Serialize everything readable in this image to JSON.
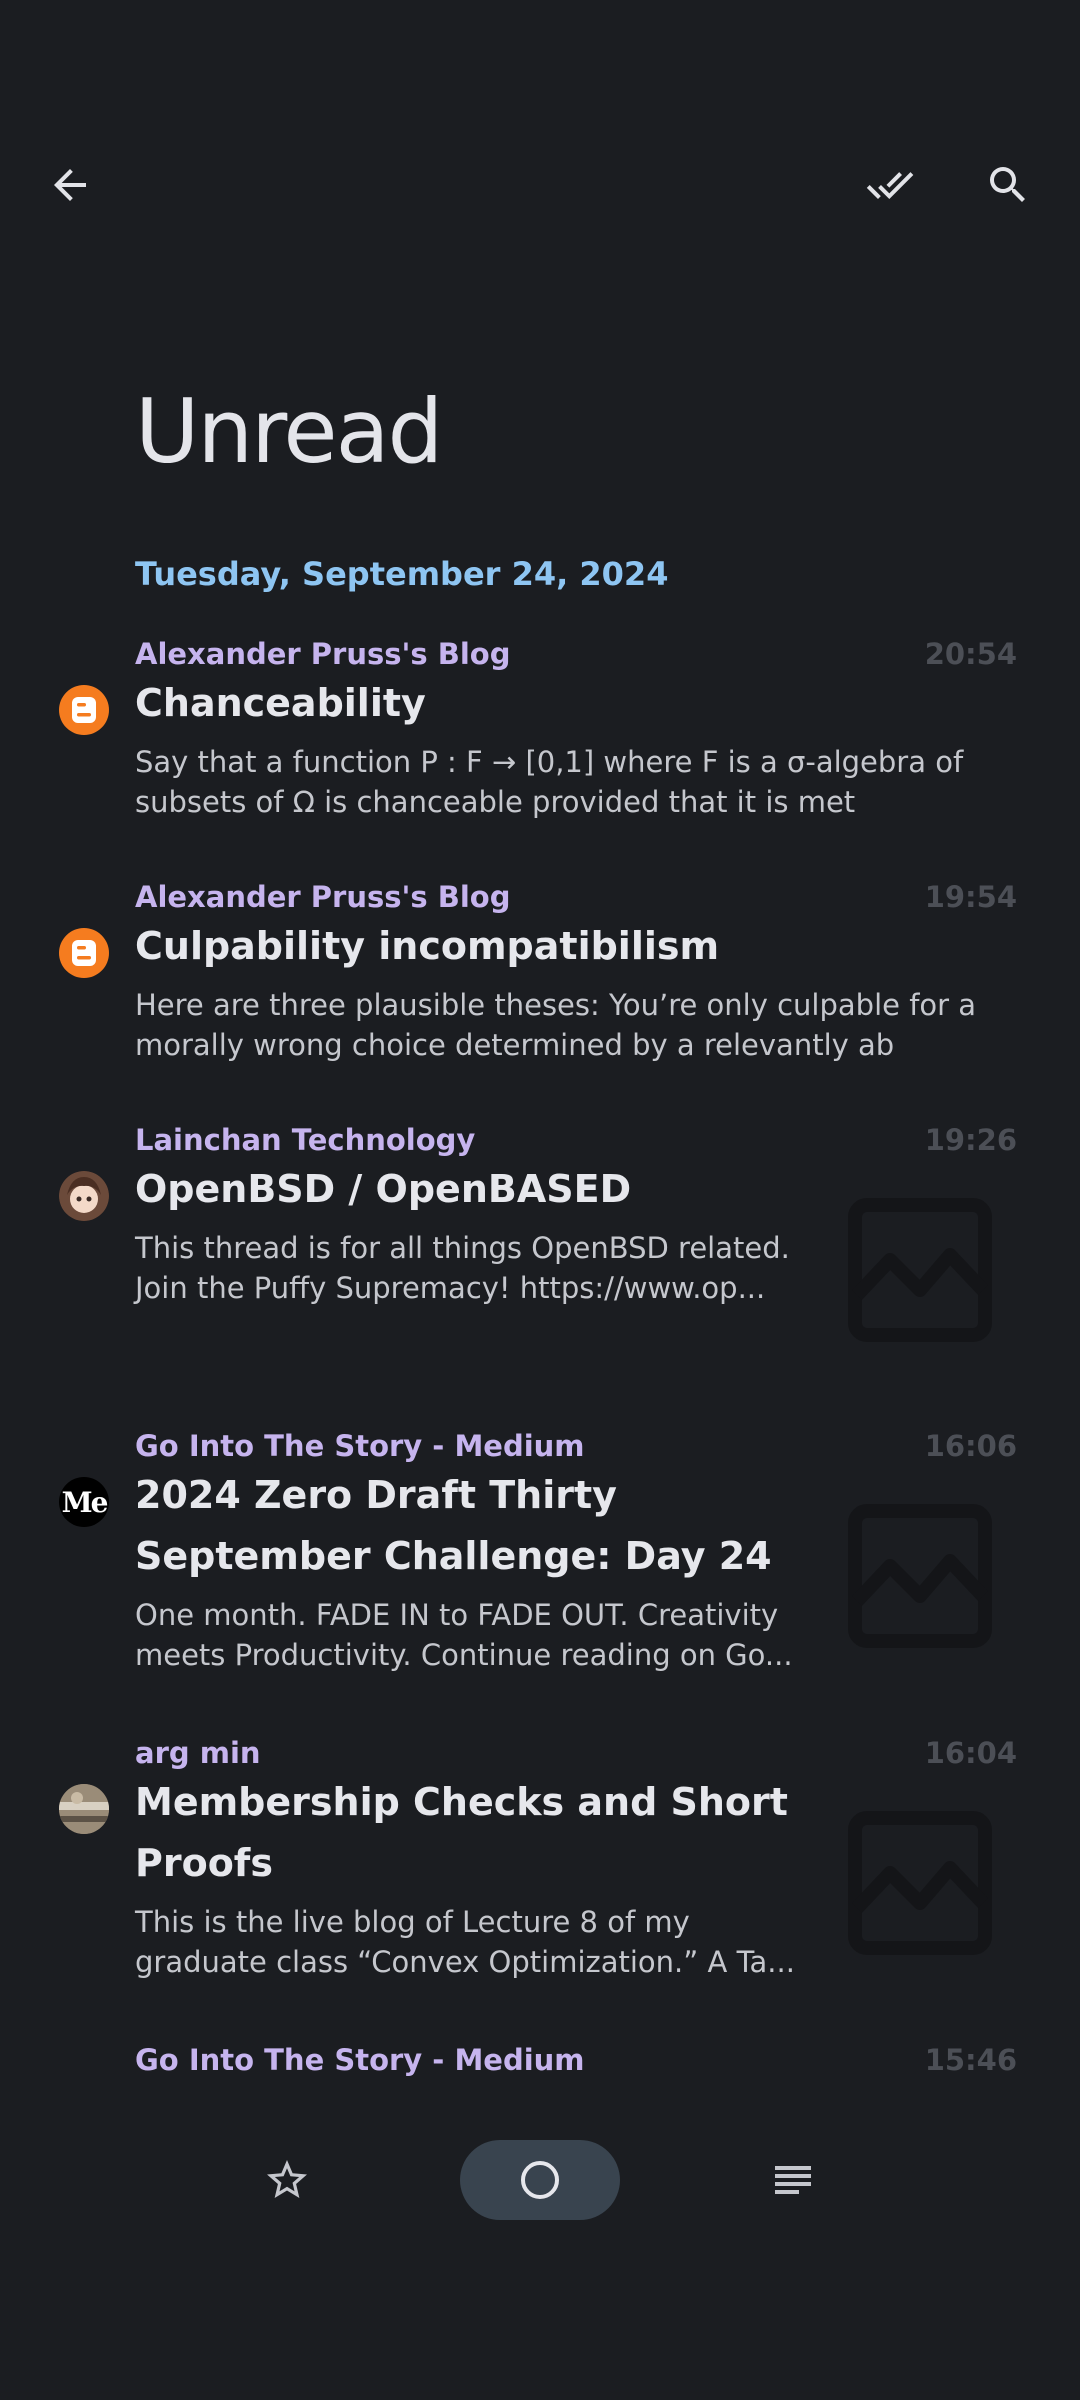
{
  "header": {
    "back_icon": "arrow-left-icon",
    "mark_all_read_icon": "double-check-icon",
    "search_icon": "search-icon"
  },
  "page": {
    "title": "Unread"
  },
  "date_header": "Tuesday, September 24, 2024",
  "articles": [
    {
      "feed": "Alexander Pruss's Blog",
      "time": "20:54",
      "title_lines": [
        "Chanceability"
      ],
      "snippet_lines": [
        "Say that a function P : F → [0,1] where F is a σ-algebra of",
        "subsets of Ω is chanceable provided that it is met"
      ],
      "avatar": "blogger-icon"
    },
    {
      "feed": "Alexander Pruss's Blog",
      "time": "19:54",
      "title_lines": [
        "Culpability incompatibilism"
      ],
      "snippet_lines": [
        "Here are three plausible theses: You’re only culpable for a",
        "morally wrong choice determined by a relevantly ab"
      ],
      "avatar": "blogger-icon"
    },
    {
      "feed": "Lainchan Technology",
      "time": "19:26",
      "title_lines": [
        "OpenBSD / OpenBASED"
      ],
      "snippet_lines": [
        "This thread is for all things OpenBSD related.",
        "Join the Puffy Supremacy! https://www.op..."
      ],
      "avatar": "anime-avatar-icon"
    },
    {
      "feed": "Go Into The Story - Medium",
      "time": "16:06",
      "title_lines": [
        "2024 Zero Draft Thirty",
        "September Challenge: Day 24"
      ],
      "snippet_lines": [
        "One month. FADE IN to FADE OUT. Creativity",
        "meets Productivity. Continue reading on Go..."
      ],
      "avatar": "medium-icon",
      "avatar_text": "Me"
    },
    {
      "feed": "arg min",
      "time": "16:04",
      "title_lines": [
        "Membership Checks and Short",
        "Proofs"
      ],
      "snippet_lines": [
        "This is the live blog of Lecture 8 of my",
        "graduate class “Convex Optimization.” A Ta..."
      ],
      "avatar": "photo-avatar-icon"
    },
    {
      "feed": "Go Into The Story - Medium",
      "time": "15:46"
    }
  ],
  "bottom_nav": {
    "starred_icon": "star-icon",
    "unread_icon": "circle-icon",
    "all_icon": "list-icon",
    "selected": "unread"
  },
  "colors": {
    "background": "#1b1d21",
    "accent_date": "#8ec5f2",
    "feed_name": "#c6b4ee",
    "selected_nav": "#39444f",
    "blogger_orange": "#f57c1f"
  }
}
